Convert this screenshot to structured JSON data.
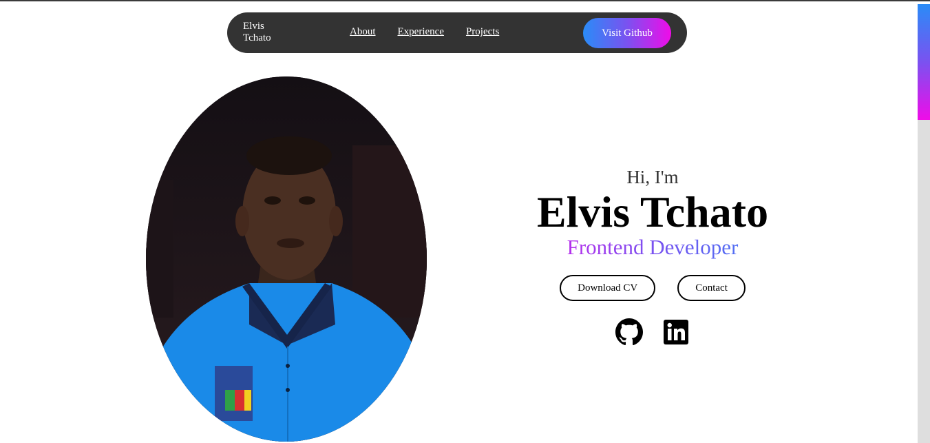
{
  "nav": {
    "brand": "Elvis Tchato",
    "links": [
      "About",
      "Experience",
      "Projects"
    ],
    "github_button": "Visit Github"
  },
  "hero": {
    "greeting": "Hi, I'm",
    "name": "Elvis Tchato",
    "role": "Frontend Developer",
    "buttons": {
      "download_cv": "Download CV",
      "contact": "Contact"
    },
    "social_icons": [
      "github-icon",
      "linkedin-icon"
    ],
    "portrait": "profile-photo"
  },
  "colors": {
    "accent_blue": "#2a8cf7",
    "accent_purple": "#7a52f0",
    "accent_magenta": "#f00ce8",
    "navbar_bg": "#333333"
  }
}
